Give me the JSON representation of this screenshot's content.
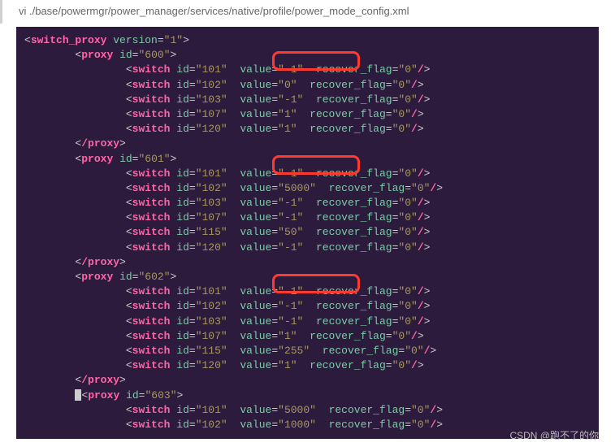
{
  "header": {
    "command": "vi ./base/powermgr/power_manager/services/native/profile/power_mode_config.xml"
  },
  "code": {
    "root_tag": "switch_proxy",
    "root_attr_name": "version",
    "root_attr_val": "\"1\"",
    "proxies": [
      {
        "id": "\"600\"",
        "switches": [
          {
            "id": "\"101\"",
            "value": "\"-1\"",
            "recover": "\"0\""
          },
          {
            "id": "\"102\"",
            "value": "\"0\"",
            "recover": "\"0\""
          },
          {
            "id": "\"103\"",
            "value": "\"-1\"",
            "recover": "\"0\""
          },
          {
            "id": "\"107\"",
            "value": "\"1\"",
            "recover": "\"0\""
          },
          {
            "id": "\"120\"",
            "value": "\"1\"",
            "recover": "\"0\""
          }
        ]
      },
      {
        "id": "\"601\"",
        "switches": [
          {
            "id": "\"101\"",
            "value": "\"-1\"",
            "recover": "\"0\""
          },
          {
            "id": "\"102\"",
            "value": "\"5000\"",
            "recover": "\"0\""
          },
          {
            "id": "\"103\"",
            "value": "\"-1\"",
            "recover": "\"0\""
          },
          {
            "id": "\"107\"",
            "value": "\"-1\"",
            "recover": "\"0\""
          },
          {
            "id": "\"115\"",
            "value": "\"50\"",
            "recover": "\"0\""
          },
          {
            "id": "\"120\"",
            "value": "\"-1\"",
            "recover": "\"0\""
          }
        ]
      },
      {
        "id": "\"602\"",
        "switches": [
          {
            "id": "\"101\"",
            "value": "\"-1\"",
            "recover": "\"0\""
          },
          {
            "id": "\"102\"",
            "value": "\"-1\"",
            "recover": "\"0\""
          },
          {
            "id": "\"103\"",
            "value": "\"-1\"",
            "recover": "\"0\""
          },
          {
            "id": "\"107\"",
            "value": "\"1\"",
            "recover": "\"0\""
          },
          {
            "id": "\"115\"",
            "value": "\"255\"",
            "recover": "\"0\""
          },
          {
            "id": "\"120\"",
            "value": "\"1\"",
            "recover": "\"0\""
          }
        ]
      },
      {
        "id": "\"603\"",
        "switches": [
          {
            "id": "\"101\"",
            "value": "\"5000\"",
            "recover": "\"0\""
          },
          {
            "id": "\"102\"",
            "value": "\"1000\"",
            "recover": "\"0\""
          }
        ]
      }
    ]
  },
  "watermark": "CSDN @跑不了的你"
}
